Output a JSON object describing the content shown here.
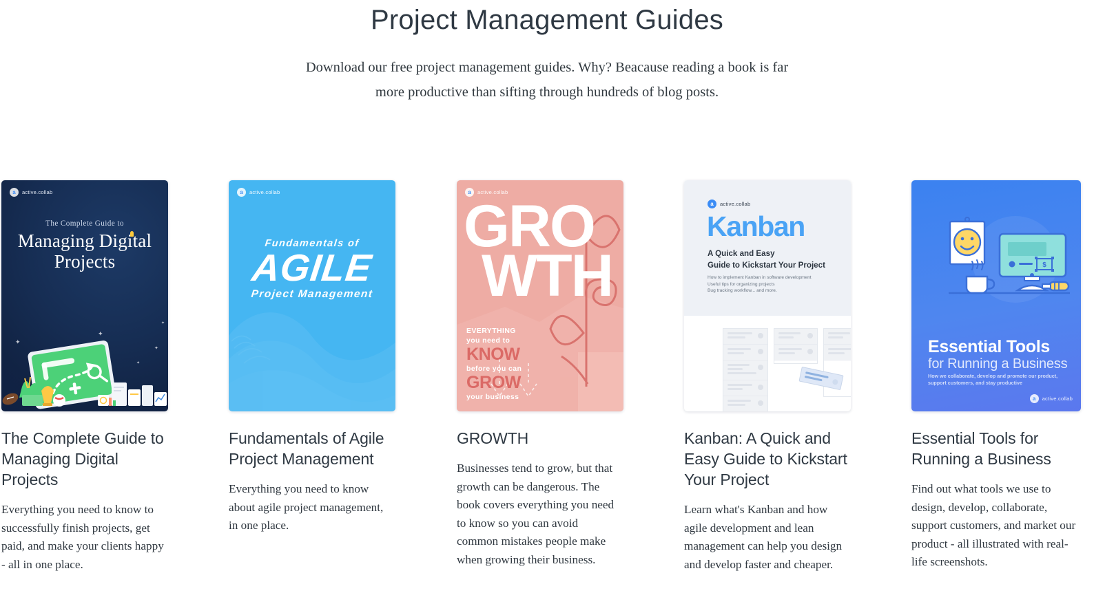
{
  "header": {
    "title": "Project Management Guides",
    "subtitle": "Download our free project management guides. Why? Beacause reading a book is far more productive than sifting through hundreds of blog posts."
  },
  "brand": {
    "name": "active.collab",
    "accent": "#3b8cf5"
  },
  "cards": [
    {
      "title": "The Complete Guide to Managing Digital Projects",
      "description": "Everything you need to know to successfully finish projects, get paid, and make your clients happy - all in one place.",
      "cover": {
        "style": "digital",
        "background": "#122446",
        "eyebrow": "The Complete Guide to",
        "title_line1": "Managing Digital",
        "title_line2": "Projects"
      }
    },
    {
      "title": "Fundamentals of Agile Project Management",
      "description": "Everything you need to know about agile project management, in one place.",
      "cover": {
        "style": "agile",
        "background": "#45b6f2",
        "line1": "Fundamentals of",
        "line2": "AGILE",
        "line3": "Project Management"
      }
    },
    {
      "title": "GROWTH",
      "description": "Businesses tend to grow, but that growth can be dangerous. The book covers everything you need to know so you can avoid common mistakes people make when growing their business.",
      "cover": {
        "style": "growth",
        "background": "#eeaca4",
        "word1": "GRO",
        "word2": "WTH",
        "tag1": "EVERYTHING",
        "tag2": "you need to",
        "tag3": "KNOW",
        "tag4": "before you can",
        "tag5": "GROW",
        "tag6": "your business"
      }
    },
    {
      "title": "Kanban: A Quick and Easy Guide to Kickstart Your Project",
      "description": "Learn what's Kanban and how agile development and lean management can help you design and develop faster and cheaper.",
      "cover": {
        "style": "kanban",
        "background": "#eef1f6",
        "title": "Kanban",
        "subtitle_line1": "A Quick and Easy",
        "subtitle_line2": "Guide to Kickstart Your Project",
        "bullet1": "How to implement Kanban in software development",
        "bullet2": "Useful tips for organizing projects",
        "bullet3": "Bug tracking workflow... and more."
      }
    },
    {
      "title": "Essential Tools for Running a Business",
      "description": "Find out what tools we use to design, develop, collaborate, support customers, and market our product - all illustrated with real-life screenshots.",
      "cover": {
        "style": "tools",
        "background": "#4a84ef",
        "title": "Essential Tools",
        "subtitle": "for Running a Business",
        "small_line1": "How we collaborate, develop and promote our product,",
        "small_line2": "support customers, and stay productive"
      }
    }
  ]
}
